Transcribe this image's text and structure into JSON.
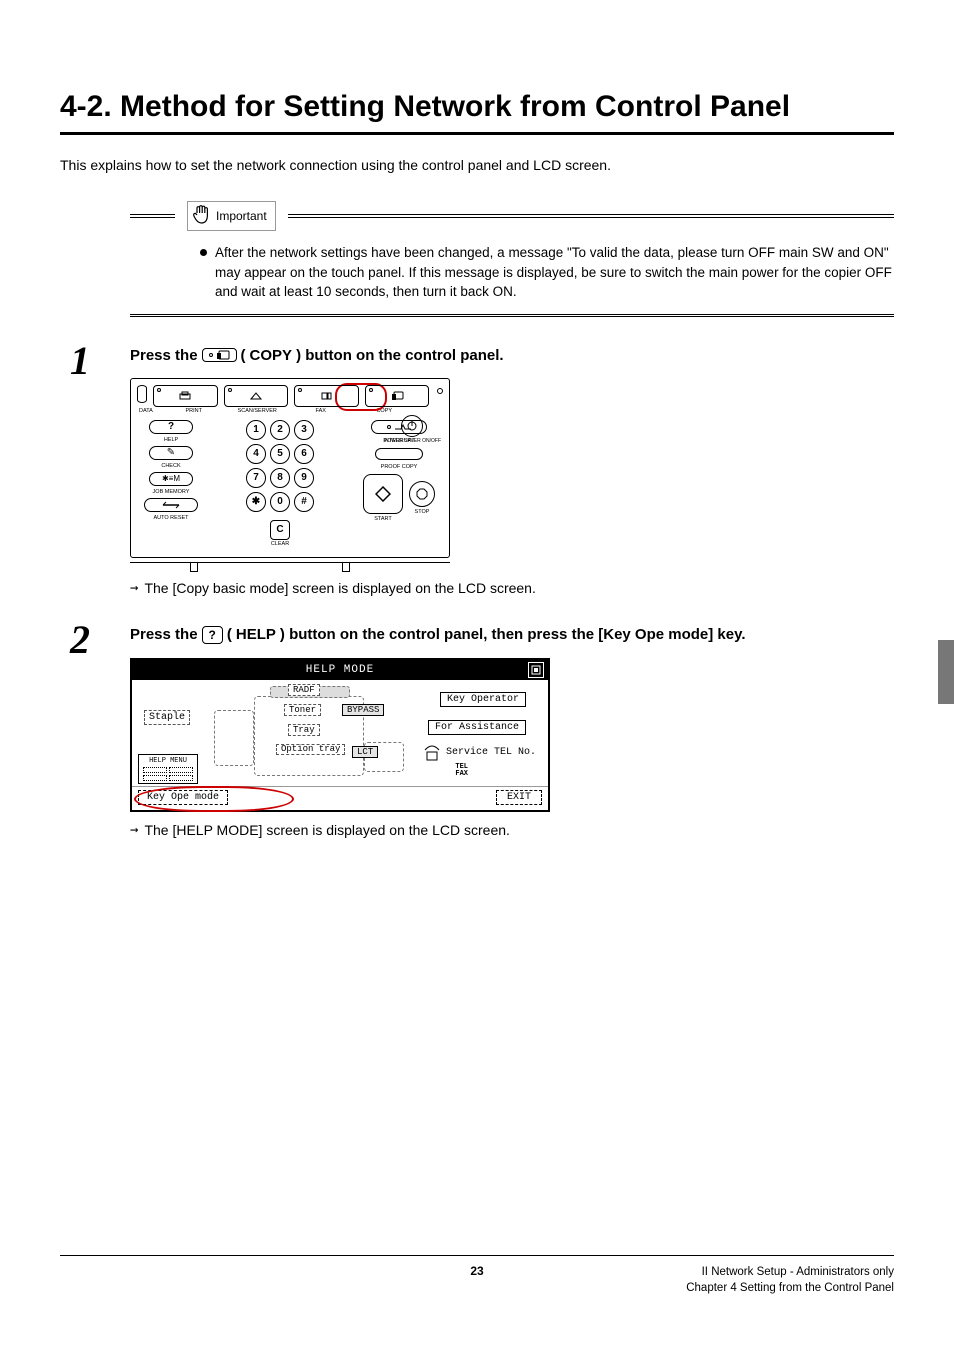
{
  "title": "4-2. Method for Setting Network from Control Panel",
  "intro": "This explains how to set the network connection using the control panel and LCD screen.",
  "important": {
    "label": "Important",
    "bullet": "After the network settings have been changed, a message \"To valid the data, please turn OFF main SW and ON\" may appear on the touch panel. If this message is displayed, be sure to switch the main power for the copier OFF and wait at least 10 seconds, then turn it back ON."
  },
  "steps": {
    "s1": {
      "num": "1",
      "pre": "Press the",
      "btn": "COPY",
      "post_open": " (",
      "post_btn": "COPY",
      "post_close": ") button on the control panel.",
      "result": "The [Copy basic mode] screen is displayed on the LCD screen."
    },
    "s2": {
      "num": "2",
      "pre": "Press the",
      "btn": "?",
      "post_open": " (",
      "post_btn": "HELP",
      "post_close": ") button on the control panel, then press the [Key Ope mode] key.",
      "result": "The [HELP MODE] screen is displayed on the LCD screen."
    }
  },
  "panel": {
    "data": "DATA",
    "modes": {
      "print": "PRINT",
      "scan": "SCAN/SERVER",
      "fax": "FAX",
      "copy": "COPY"
    },
    "left": {
      "help": "HELP",
      "check": "CHECK",
      "jobmem": "JOB MEMORY",
      "autoreset": "AUTO RESET"
    },
    "keypad": {
      "k1": "1",
      "k2": "2",
      "k3": "3",
      "k4": "4",
      "k5": "5",
      "k6": "6",
      "k7": "7",
      "k8": "8",
      "k9": "9",
      "star": "✱",
      "k0": "0",
      "hash": "#",
      "c": "C",
      "clear": "CLEAR"
    },
    "right": {
      "power": "POWER SAVER ON/OFF",
      "interrupt": "INTERRUPT",
      "proof": "PROOF COPY",
      "stop": "STOP",
      "start": "START"
    }
  },
  "lcd": {
    "title": "HELP MODE",
    "staple": "Staple",
    "radf": "RADF",
    "toner": "Toner",
    "tray": "Tray",
    "option_tray": "Option tray",
    "bypass": "BYPASS",
    "lct": "LCT",
    "helpmenu": "HELP MENU",
    "keyop": "Key Operator",
    "assist": "For Assistance",
    "service": "Service TEL No.",
    "tel": "TEL",
    "fax": "FAX",
    "kope": "Key Ope mode",
    "exit": "EXIT"
  },
  "footer": {
    "page": "23",
    "r1": "II Network Setup - Administrators only",
    "r2": "Chapter 4 Setting from the Control Panel"
  }
}
